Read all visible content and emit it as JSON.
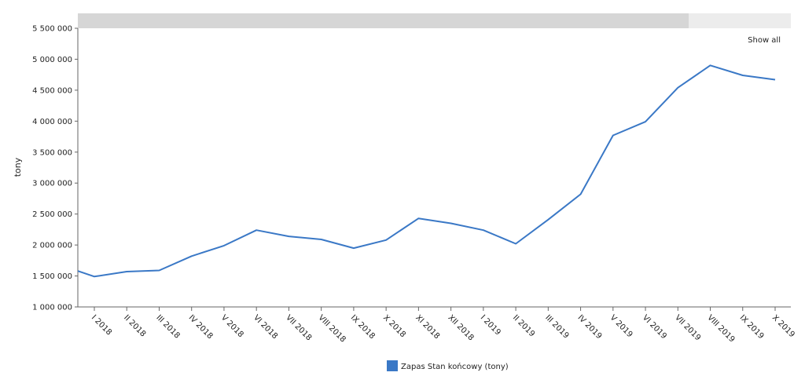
{
  "controls": {
    "show_all_label": "Show all"
  },
  "colors": {
    "series": "#3a78c6",
    "scrollbar_thumb": "#d6d6d6",
    "scrollbar_track": "#ececec",
    "axis": "#666666"
  },
  "chart_data": {
    "type": "line",
    "ylabel": "tony",
    "xlabel": "",
    "ylim": [
      1000000,
      5500000
    ],
    "y_ticks": [
      1000000,
      1500000,
      2000000,
      2500000,
      3000000,
      3500000,
      4000000,
      4500000,
      5000000,
      5500000
    ],
    "y_tick_labels": [
      "1 000 000",
      "1 500 000",
      "2 000 000",
      "2 500 000",
      "3 000 000",
      "3 500 000",
      "4 000 000",
      "4 500 000",
      "5 000 000",
      "5 500 000"
    ],
    "categories": [
      "I 2018",
      "II 2018",
      "III 2018",
      "IV 2018",
      "V 2018",
      "VI 2018",
      "VII 2018",
      "VIII 2018",
      "IX 2018",
      "X 2018",
      "XI 2018",
      "XII 2018",
      "I 2019",
      "II 2019",
      "III 2019",
      "IV 2019",
      "V 2019",
      "VI 2019",
      "VII 2019",
      "VIII 2019",
      "IX 2019",
      "X 2019"
    ],
    "series": [
      {
        "name": "Zapas Stan końcowy (tony)",
        "start_value": 1580000,
        "values": [
          1490000,
          1570000,
          1590000,
          1820000,
          1990000,
          2240000,
          2140000,
          2090000,
          1950000,
          2080000,
          2430000,
          2350000,
          2240000,
          2020000,
          2410000,
          2820000,
          3770000,
          3990000,
          4540000,
          4900000,
          4740000,
          4670000
        ]
      }
    ],
    "grid": false,
    "legend": "bottom-center"
  }
}
